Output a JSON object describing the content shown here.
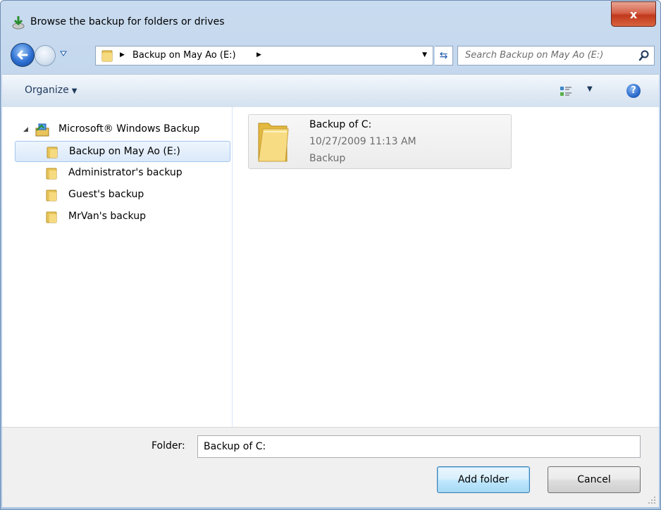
{
  "window": {
    "title": "Browse the backup for folders or drives",
    "close_label": "x"
  },
  "address": {
    "path": "Backup on May Ao (E:)"
  },
  "search": {
    "placeholder": "Search Backup on May Ao (E:)"
  },
  "toolbar": {
    "organize_label": "Organize",
    "help_label": "?"
  },
  "tree": {
    "root_label": "Microsoft® Windows Backup",
    "items": [
      {
        "label": "Backup on May Ao (E:)",
        "selected": true
      },
      {
        "label": "Administrator's backup",
        "selected": false
      },
      {
        "label": "Guest's backup",
        "selected": false
      },
      {
        "label": "MrVan's backup",
        "selected": false
      }
    ]
  },
  "content": {
    "items": [
      {
        "name": "Backup of C:",
        "date": "10/27/2009 11:13 AM",
        "type": "Backup"
      }
    ]
  },
  "bottom": {
    "folder_label": "Folder:",
    "folder_value": "Backup of C:",
    "add_button": "Add folder",
    "cancel_button": "Cancel"
  },
  "colors": {
    "accent": "#3c7fb1",
    "selection": "#dbe9fa"
  }
}
